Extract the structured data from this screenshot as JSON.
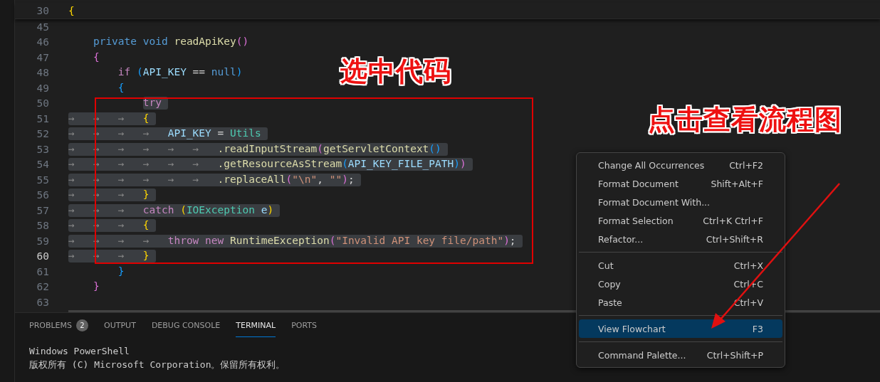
{
  "editor": {
    "sticky_line": {
      "number": "30",
      "tokens": [
        {
          "text": "{",
          "kind": "bracket1"
        }
      ]
    },
    "lines": [
      {
        "number": "45",
        "selected": false,
        "current": false
      },
      {
        "number": "46",
        "selected": false,
        "current": false,
        "tokens": [
          {
            "text": "\tprivate void ",
            "kind": "storage"
          },
          {
            "text": "readApiKey",
            "kind": "func"
          },
          {
            "text": "()",
            "kind": "bracket2"
          }
        ]
      },
      {
        "number": "47",
        "selected": false,
        "current": false,
        "tokens": [
          {
            "text": "\t{",
            "kind": "bracket2"
          }
        ]
      },
      {
        "number": "48",
        "selected": false,
        "current": false,
        "tokens": [
          {
            "text": "\t\tif ",
            "kind": "keyword"
          },
          {
            "text": "(",
            "kind": "bracket3"
          },
          {
            "text": "API_KEY",
            "kind": "var"
          },
          {
            "text": " == ",
            "kind": "plain"
          },
          {
            "text": "null",
            "kind": "storage"
          },
          {
            "text": ")",
            "kind": "bracket3"
          }
        ]
      },
      {
        "number": "49",
        "selected": false,
        "current": false,
        "tokens": [
          {
            "text": "\t\t{",
            "kind": "bracket3"
          }
        ]
      },
      {
        "number": "50",
        "selected": true,
        "current": false,
        "tokens": [
          {
            "text": "\t\t\ttry",
            "kind": "keyword"
          }
        ]
      },
      {
        "number": "51",
        "selected": true,
        "current": false,
        "tokens": [
          {
            "text": "→\t→\t→\t",
            "kind": "ws"
          },
          {
            "text": "{",
            "kind": "bracket1"
          }
        ]
      },
      {
        "number": "52",
        "selected": true,
        "current": false,
        "tokens": [
          {
            "text": "→\t→\t→\t→\t",
            "kind": "ws"
          },
          {
            "text": "API_KEY",
            "kind": "var"
          },
          {
            "text": " = ",
            "kind": "plain"
          },
          {
            "text": "Utils",
            "kind": "type"
          }
        ]
      },
      {
        "number": "53",
        "selected": true,
        "current": false,
        "tokens": [
          {
            "text": "→\t→\t→\t→\t→\t→\t",
            "kind": "ws"
          },
          {
            "text": ".readInputStream",
            "kind": "func"
          },
          {
            "text": "(",
            "kind": "bracket2"
          },
          {
            "text": "getServletContext",
            "kind": "func"
          },
          {
            "text": "()",
            "kind": "bracket3"
          }
        ]
      },
      {
        "number": "54",
        "selected": true,
        "current": false,
        "tokens": [
          {
            "text": "→\t→\t→\t→\t→\t→\t",
            "kind": "ws"
          },
          {
            "text": ".getResourceAsStream",
            "kind": "func"
          },
          {
            "text": "(",
            "kind": "bracket3"
          },
          {
            "text": "API_KEY_FILE_PATH",
            "kind": "var"
          },
          {
            "text": ")",
            "kind": "bracket3"
          },
          {
            "text": ")",
            "kind": "bracket2"
          }
        ]
      },
      {
        "number": "55",
        "selected": true,
        "current": false,
        "tokens": [
          {
            "text": "→\t→\t→\t→\t→\t→\t",
            "kind": "ws"
          },
          {
            "text": ".replaceAll",
            "kind": "func"
          },
          {
            "text": "(",
            "kind": "bracket2"
          },
          {
            "text": "\"\\n\"",
            "kind": "string"
          },
          {
            "text": ", ",
            "kind": "plain"
          },
          {
            "text": "\"\"",
            "kind": "string"
          },
          {
            "text": ")",
            "kind": "bracket2"
          },
          {
            "text": ";",
            "kind": "plain"
          }
        ]
      },
      {
        "number": "56",
        "selected": true,
        "current": false,
        "tokens": [
          {
            "text": "→\t→\t→\t",
            "kind": "ws"
          },
          {
            "text": "}",
            "kind": "bracket1"
          }
        ]
      },
      {
        "number": "57",
        "selected": true,
        "current": false,
        "tokens": [
          {
            "text": "→\t→\t→\t",
            "kind": "ws"
          },
          {
            "text": "catch ",
            "kind": "keyword"
          },
          {
            "text": "(",
            "kind": "bracket1"
          },
          {
            "text": "IOException",
            "kind": "type"
          },
          {
            "text": " e",
            "kind": "var"
          },
          {
            "text": ")",
            "kind": "bracket1"
          }
        ]
      },
      {
        "number": "58",
        "selected": true,
        "current": false,
        "tokens": [
          {
            "text": "→\t→\t→\t",
            "kind": "ws"
          },
          {
            "text": "{",
            "kind": "bracket1"
          }
        ]
      },
      {
        "number": "59",
        "selected": true,
        "current": false,
        "tokens": [
          {
            "text": "→\t→\t→\t→\t",
            "kind": "ws"
          },
          {
            "text": "throw new ",
            "kind": "keyword"
          },
          {
            "text": "RuntimeException",
            "kind": "func"
          },
          {
            "text": "(",
            "kind": "bracket2"
          },
          {
            "text": "\"Invalid API key file/path\"",
            "kind": "string"
          },
          {
            "text": ")",
            "kind": "bracket2"
          },
          {
            "text": ";",
            "kind": "plain"
          }
        ]
      },
      {
        "number": "60",
        "selected": true,
        "current": true,
        "tokens": [
          {
            "text": "→\t→\t→\t",
            "kind": "ws"
          },
          {
            "text": "}",
            "kind": "bracket1"
          }
        ]
      },
      {
        "number": "61",
        "selected": false,
        "current": false,
        "tokens": [
          {
            "text": "\t\t}",
            "kind": "bracket3"
          }
        ]
      },
      {
        "number": "62",
        "selected": false,
        "current": false,
        "tokens": [
          {
            "text": "\t}",
            "kind": "bracket2"
          }
        ]
      },
      {
        "number": "63",
        "selected": false,
        "current": false
      }
    ]
  },
  "panel": {
    "tabs": [
      {
        "label": "PROBLEMS",
        "badge": "2",
        "selected": false
      },
      {
        "label": "OUTPUT",
        "selected": false
      },
      {
        "label": "DEBUG CONSOLE",
        "selected": false
      },
      {
        "label": "TERMINAL",
        "selected": true
      },
      {
        "label": "PORTS",
        "selected": false
      }
    ],
    "terminal_lines": [
      "Windows PowerShell",
      "版权所有 (C) Microsoft Corporation。保留所有权利。"
    ]
  },
  "context_menu": {
    "groups": [
      [
        {
          "label": "Change All Occurrences",
          "shortcut": "Ctrl+F2",
          "selected": false
        },
        {
          "label": "Format Document",
          "shortcut": "Shift+Alt+F",
          "selected": false
        },
        {
          "label": "Format Document With...",
          "selected": false
        },
        {
          "label": "Format Selection",
          "shortcut": "Ctrl+K Ctrl+F",
          "selected": false
        },
        {
          "label": "Refactor...",
          "shortcut": "Ctrl+Shift+R",
          "selected": false
        }
      ],
      [
        {
          "label": "Cut",
          "shortcut": "Ctrl+X",
          "selected": false
        },
        {
          "label": "Copy",
          "shortcut": "Ctrl+C",
          "selected": false
        },
        {
          "label": "Paste",
          "shortcut": "Ctrl+V",
          "selected": false
        }
      ],
      [
        {
          "label": "View Flowchart",
          "shortcut": "F3",
          "selected": true
        }
      ],
      [
        {
          "label": "Command Palette...",
          "shortcut": "Ctrl+Shift+P",
          "selected": false
        }
      ]
    ]
  },
  "annotations": [
    {
      "kind": "box"
    },
    {
      "kind": "label",
      "text": "选中代码"
    },
    {
      "kind": "label",
      "text": "点击查看流程图"
    },
    {
      "kind": "arrow"
    }
  ]
}
